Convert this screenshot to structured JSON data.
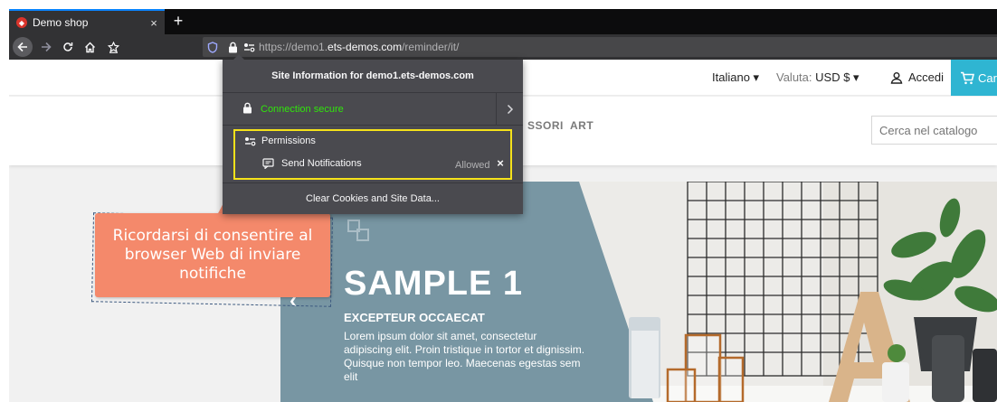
{
  "browser": {
    "tab_title": "Demo shop",
    "tab_close": "×",
    "new_tab": "+",
    "url_prefix": "https://demo1.",
    "url_domain": "ets-demos.com",
    "url_path": "/reminder/it/"
  },
  "header": {
    "language": "Italiano ▾",
    "currency_label": "Valuta:",
    "currency_value": "USD $ ▾",
    "login": "Accedi",
    "cart": "Carrello"
  },
  "menu": {
    "accessories_partial": "SSORI",
    "art": "ART",
    "search_placeholder": "Cerca nel catalogo"
  },
  "popup": {
    "title": "Site Information for demo1.ets-demos.com",
    "connection": "Connection secure",
    "permissions_heading": "Permissions",
    "permission_name": "Send Notifications",
    "permission_state": "Allowed",
    "remove": "×",
    "clear_button": "Clear Cookies and Site Data..."
  },
  "callout": {
    "text": "Ricordarsi di consentire al browser Web di inviare notifiche"
  },
  "slider": {
    "title": "SAMPLE 1",
    "subtitle": "EXCEPTEUR OCCAECAT",
    "body": "Lorem ipsum dolor sit amet, consectetur adipiscing elit. Proin tristique in tortor et dignissim. Quisque non tempor leo. Maecenas egestas sem elit",
    "prev": "‹"
  },
  "colors": {
    "accent_cart": "#2fb5d2",
    "popup_bg": "#4a4a4f",
    "secure_green": "#30e60b",
    "highlight_yellow": "#f5e21a",
    "callout_salmon": "#f4896b",
    "slide_panel": "#7896a3"
  }
}
